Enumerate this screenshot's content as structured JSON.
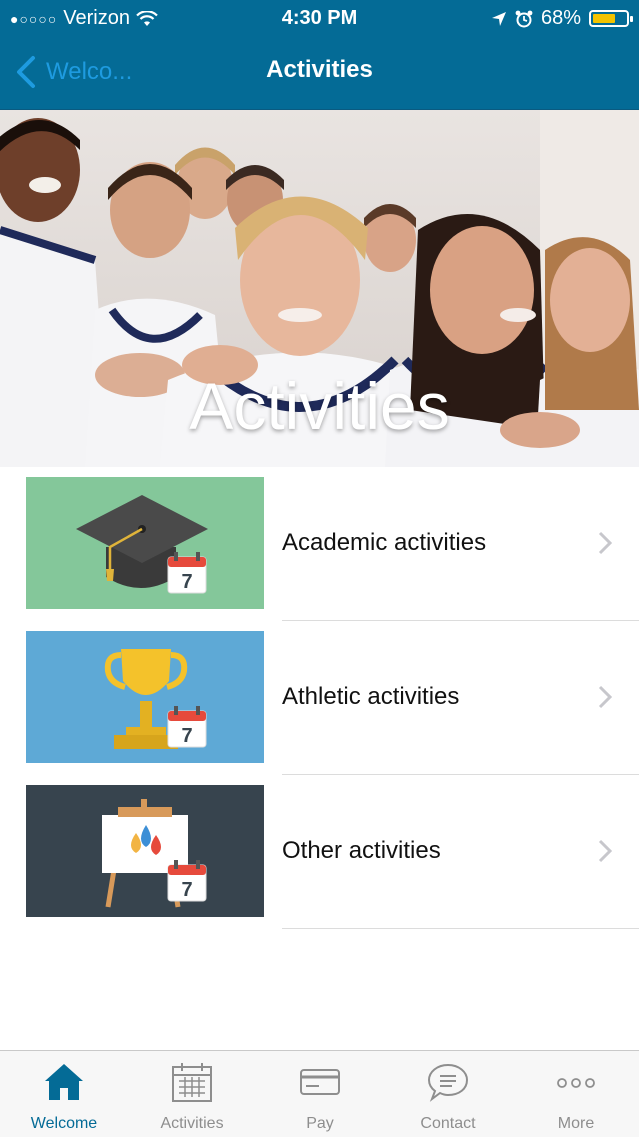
{
  "status_bar": {
    "signal_dots": "●○○○○",
    "carrier": "Verizon",
    "time": "4:30 PM",
    "battery_text": "68%",
    "battery_level": 0.68
  },
  "nav": {
    "back_label": "Welco...",
    "title": "Activities"
  },
  "hero": {
    "title": "Activities"
  },
  "activities": [
    {
      "label": "Academic activities",
      "thumb_color": "#84c79a",
      "icon": "graduation-cap-icon"
    },
    {
      "label": "Athletic activities",
      "thumb_color": "#5ea9d6",
      "icon": "trophy-icon"
    },
    {
      "label": "Other activities",
      "thumb_color": "#37444e",
      "icon": "easel-icon"
    }
  ],
  "calendar_day": "7",
  "tabs": [
    {
      "label": "Welcome",
      "icon": "home-icon",
      "active": true
    },
    {
      "label": "Activities",
      "icon": "calendar-icon",
      "active": false
    },
    {
      "label": "Pay",
      "icon": "credit-card-icon",
      "active": false
    },
    {
      "label": "Contact",
      "icon": "chat-bubble-icon",
      "active": false
    },
    {
      "label": "More",
      "icon": "more-icon",
      "active": false
    }
  ],
  "colors": {
    "brand": "#046b96",
    "back_link": "#1e9be0",
    "battery": "#f4c300"
  }
}
